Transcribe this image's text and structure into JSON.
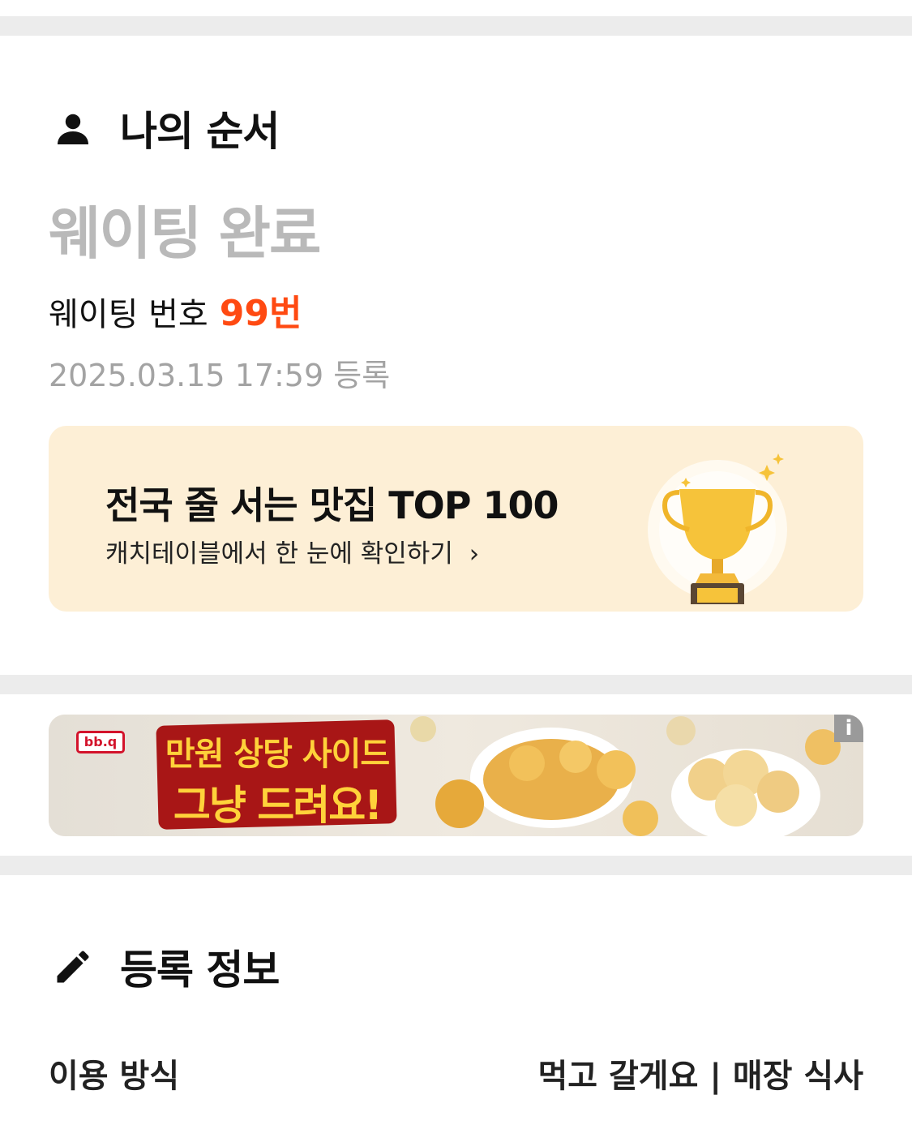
{
  "my_order": {
    "title": "나의 순서",
    "icon": "person-icon",
    "status": "웨이팅 완료",
    "waiting_number_label": "웨이팅 번호",
    "waiting_number": "99번",
    "registered_at": "2025.03.15 17:59 등록"
  },
  "promo": {
    "title": "전국 줄 서는 맛집 TOP 100",
    "subtitle": "캐치테이블에서 한 눈에 확인하기",
    "chevron": "›",
    "icon": "trophy-icon",
    "background": "#fdefd6"
  },
  "ad": {
    "brand": "bb.q",
    "line1": "만원 상당 사이드",
    "line2": "그냥 드려요!",
    "info_badge": "i"
  },
  "registration": {
    "title": "등록 정보",
    "icon": "pencil-icon",
    "rows": [
      {
        "label": "이용 방식",
        "value": "먹고 갈게요 | 매장 식사"
      }
    ]
  },
  "colors": {
    "accent": "#ff4a12",
    "muted": "#b9b9b9",
    "separator": "#ececec"
  }
}
